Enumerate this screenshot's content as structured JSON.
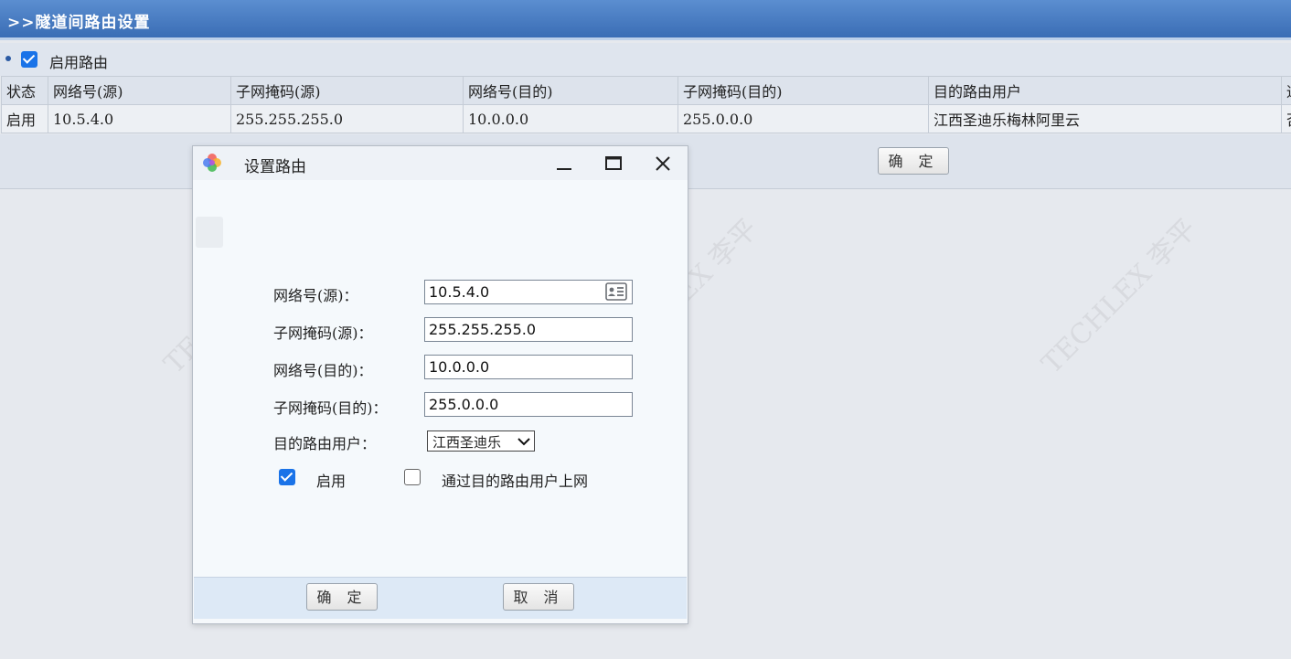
{
  "header": {
    "title": ">>隧道间路由设置"
  },
  "enable_routing": {
    "label": "启用路由",
    "checked": true
  },
  "table": {
    "columns": [
      "状态",
      "网络号(源)",
      "子网掩码(源)",
      "网络号(目的)",
      "子网掩码(目的)",
      "目的路由用户",
      "通"
    ],
    "rows": [
      [
        "启用",
        "10.5.4.0",
        "255.255.255.0",
        "10.0.0.0",
        "255.0.0.0",
        "江西圣迪乐梅林阿里云",
        "否"
      ]
    ]
  },
  "page_confirm_label": "确 定",
  "watermark": {
    "text": "TECHLEX 李平"
  },
  "dialog": {
    "title": "设置路由",
    "fields": {
      "src_net": {
        "label": "网络号(源)：",
        "value": "10.5.4.0"
      },
      "src_mask": {
        "label": "子网掩码(源)：",
        "value": "255.255.255.0"
      },
      "dst_net": {
        "label": "网络号(目的)：",
        "value": "10.0.0.0"
      },
      "dst_mask": {
        "label": "子网掩码(目的)：",
        "value": "255.0.0.0"
      }
    },
    "route_user": {
      "label": "目的路由用户：",
      "selected": "江西圣迪乐"
    },
    "enable": {
      "label": "启用",
      "checked": true
    },
    "via_user": {
      "label": "通过目的路由用户上网",
      "checked": false
    },
    "ok_label": "确 定",
    "cancel_label": "取 消"
  }
}
